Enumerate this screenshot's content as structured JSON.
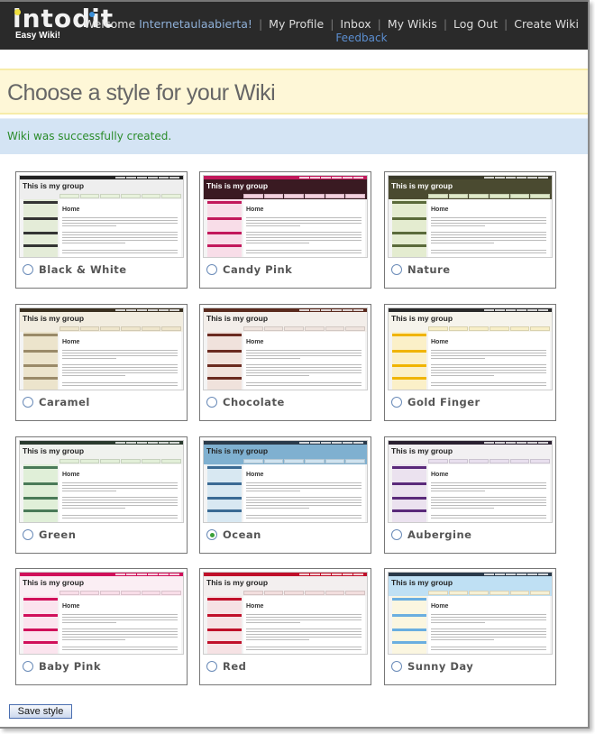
{
  "header": {
    "logo_text": "intodit",
    "logo_tagline": "Easy Wiki!",
    "welcome_prefix": "Welcome",
    "username": "Internetaulaabierta!",
    "nav": {
      "profile": "My Profile",
      "inbox": "Inbox",
      "feedback": "Feedback",
      "wikis": "My Wikis",
      "logout": "Log Out",
      "create": "Create Wiki"
    },
    "separator": "|"
  },
  "page": {
    "title": "Choose a style for your Wiki",
    "message": "Wiki was successfully created."
  },
  "thumbnail": {
    "group_title": "This is my group",
    "home_heading": "Home"
  },
  "styles": [
    {
      "label": "Black & White",
      "selected": false,
      "bar": "#222222",
      "head": "#eeeeee",
      "side": "#e4ecd8",
      "sbar": "#333333",
      "tab": "#e8f2dc",
      "tt": "#222222"
    },
    {
      "label": "Candy Pink",
      "selected": false,
      "bar": "#c2185b",
      "head": "#3a1a22",
      "side": "#f8dde8",
      "sbar": "#c2185b",
      "tab": "#f4d0de",
      "tt": "#ffffff"
    },
    {
      "label": "Nature",
      "selected": false,
      "bar": "#3a3a2a",
      "head": "#4a4a30",
      "side": "#e4ecd0",
      "sbar": "#5a6a3a",
      "tab": "#dfe9c8",
      "tt": "#ffffff"
    },
    {
      "label": "Caramel",
      "selected": false,
      "bar": "#3a3020",
      "head": "#f2ede0",
      "side": "#ece4cc",
      "sbar": "#9a8a68",
      "tab": "#efe6cc",
      "tt": "#222222"
    },
    {
      "label": "Chocolate",
      "selected": false,
      "bar": "#5a2a1e",
      "head": "#f3eeea",
      "side": "#f0e2dc",
      "sbar": "#6a2a20",
      "tab": "#efe4de",
      "tt": "#222222"
    },
    {
      "label": "Gold Finger",
      "selected": false,
      "bar": "#2a2a2a",
      "head": "#f6f4ec",
      "side": "#fbf0c8",
      "sbar": "#f0b400",
      "tab": "#f8efc8",
      "tt": "#222222"
    },
    {
      "label": "Green",
      "selected": false,
      "bar": "#2a3a2e",
      "head": "#f0f2ee",
      "side": "#e0efd8",
      "sbar": "#4a7a58",
      "tab": "#e2efd8",
      "tt": "#222222"
    },
    {
      "label": "Ocean",
      "selected": true,
      "bar": "#2a3a4a",
      "head": "#7fb0d0",
      "side": "#d8e8f2",
      "sbar": "#3a6a94",
      "tab": "#cfe3f0",
      "tt": "#222222"
    },
    {
      "label": "Aubergine",
      "selected": false,
      "bar": "#2a2030",
      "head": "#f2f0f2",
      "side": "#ebe2ef",
      "sbar": "#5a2a7a",
      "tab": "#e8dfee",
      "tt": "#222222"
    },
    {
      "label": "Baby Pink",
      "selected": false,
      "bar": "#d0105a",
      "head": "#fbeef4",
      "side": "#fbe4ee",
      "sbar": "#d0105a",
      "tab": "#f8dde8",
      "tt": "#222222"
    },
    {
      "label": "Red",
      "selected": false,
      "bar": "#c0102a",
      "head": "#f3efef",
      "side": "#f6e2e4",
      "sbar": "#c0102a",
      "tab": "#f2dede",
      "tt": "#222222"
    },
    {
      "label": "Sunny Day",
      "selected": false,
      "bar": "#2a3a4a",
      "head": "#bfe0f4",
      "side": "#fbf6e0",
      "sbar": "#6aaee0",
      "tab": "#f6f0d4",
      "tt": "#222222"
    }
  ],
  "actions": {
    "save_label": "Save style"
  },
  "colors": {
    "topbar": "#2a2a2a",
    "title_band": "#fef7d7",
    "message_band": "#d4e4f4",
    "success_text": "#2b8c2b",
    "feedback_link": "#5b8ed0"
  }
}
